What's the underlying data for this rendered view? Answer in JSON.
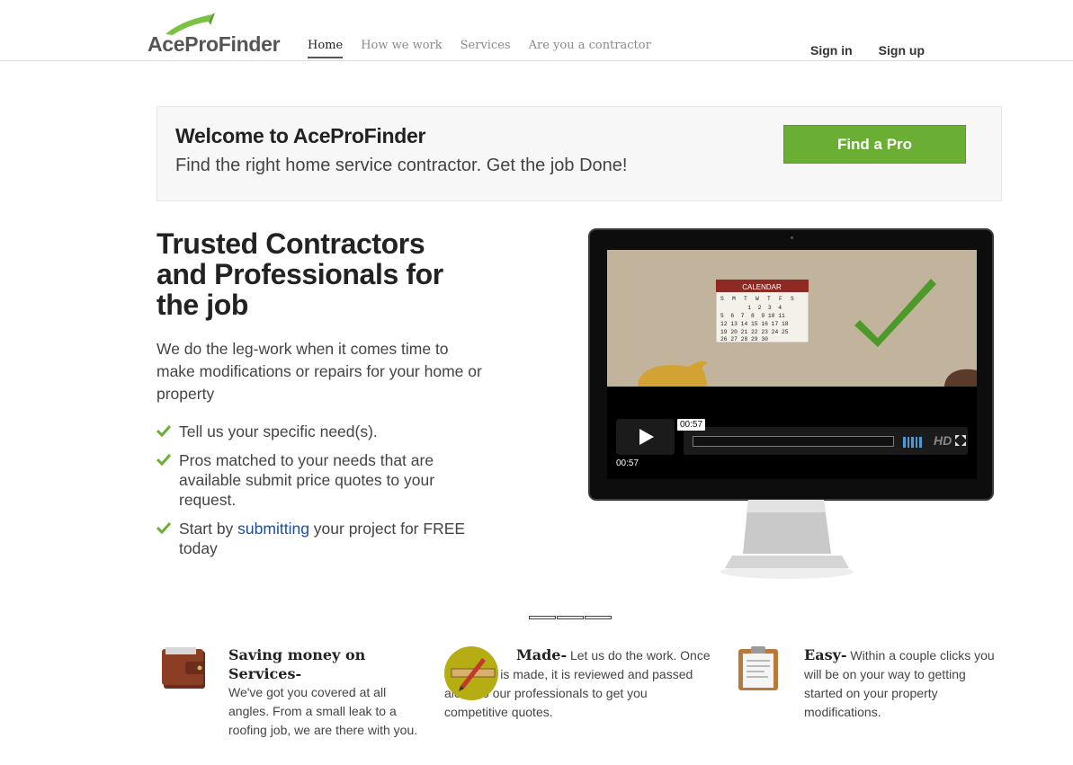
{
  "header": {
    "logo_text": "AceProFinder",
    "nav": [
      "Home",
      "How we work",
      "Services",
      "Are you a contractor"
    ],
    "sign_in": "Sign in",
    "sign_up": "Sign up"
  },
  "banner": {
    "title": "Welcome to AceProFinder",
    "subtitle": "Find the right home service contractor. Get the job Done!",
    "cta": "Find a Pro"
  },
  "hero": {
    "title": "Trusted Contractors and Professionals for the job",
    "description": "We do the leg-work when it comes time to make modifications or repairs for your home or property",
    "checklist": {
      "item1": "Tell us your specific need(s).",
      "item2": "Pros matched to your needs that are available submit price quotes to your request.",
      "item3_prefix": "Start by ",
      "item3_link": "submitting",
      "item3_suffix": " your project for FREE today"
    }
  },
  "video": {
    "calendar_title": "CALENDAR",
    "calendar_days": [
      "S",
      "M",
      "T",
      "W",
      "T",
      "F",
      "S"
    ],
    "calendar_rows": [
      "        1  2  3  4",
      "5  6  7  8  9 10 11",
      "12 13 14 15 16 17 18",
      "19 20 21 22 23 24 25",
      "26 27 28 29 30"
    ],
    "time_tooltip": "00:57",
    "time_current": "00:57",
    "hd_label": "HD"
  },
  "slider": {
    "count": 3
  },
  "features": [
    {
      "title": "Saving money on Services-",
      "text": "We've got you covered at all angles. From a small leak to a roofing job, we are there with you.",
      "icon": "wallet-icon"
    },
    {
      "title": "Made-",
      "text": "Let us do the work. Once a request is made, it is reviewed and passed along to our professionals to get you competitive quotes.",
      "icon": "pencil-ruler-icon"
    },
    {
      "title": "Easy-",
      "text": "Within a couple clicks you will be on your way to getting started on your property modifications.",
      "icon": "clipboard-icon"
    }
  ],
  "colors": {
    "accent_green": "#6bae34",
    "link_blue": "#1a4fa0",
    "volume_blue": "#4b9bd6"
  }
}
